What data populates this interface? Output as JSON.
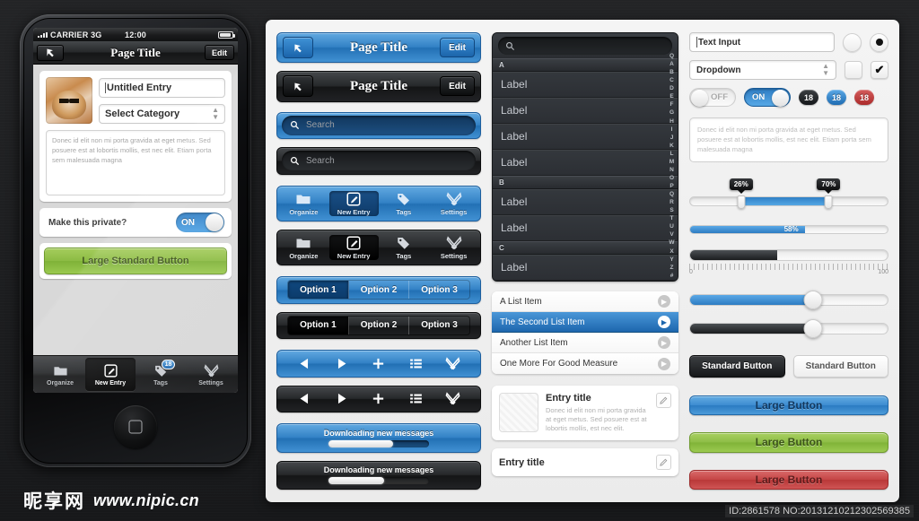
{
  "phone": {
    "status": {
      "carrier": "CARRIER 3G",
      "time": "12:00"
    },
    "nav": {
      "title": "Page Title",
      "edit": "Edit",
      "back_icon": "back-arrow-icon"
    },
    "form": {
      "title_value": "Untitled Entry",
      "category_value": "Select Category",
      "note_text": "Donec id elit non mi porta gravida at eget metus. Sed posuere est at lobortis mollis, est nec elit. Etiam porta sem malesuada magna",
      "private_label": "Make this private?",
      "toggle_state": "ON",
      "button_label": "Large Standard Button"
    },
    "tabs": [
      {
        "label": "Organize",
        "icon": "folder-icon",
        "active": false,
        "badge": ""
      },
      {
        "label": "New Entry",
        "icon": "compose-icon",
        "active": true,
        "badge": ""
      },
      {
        "label": "Tags",
        "icon": "tag-icon",
        "active": false,
        "badge": "18"
      },
      {
        "label": "Settings",
        "icon": "tools-icon",
        "active": false,
        "badge": ""
      }
    ]
  },
  "kit": {
    "navbars": [
      {
        "title": "Page Title",
        "edit": "Edit",
        "style": "blue"
      },
      {
        "title": "Page Title",
        "edit": "Edit",
        "style": "dark"
      }
    ],
    "searchbars": [
      {
        "placeholder": "Search",
        "style": "blue"
      },
      {
        "placeholder": "Search",
        "style": "dark"
      }
    ],
    "tabbars": [
      {
        "style": "blue",
        "items": [
          {
            "label": "Organize",
            "icon": "folder-icon",
            "active": false
          },
          {
            "label": "New Entry",
            "icon": "compose-icon",
            "active": true
          },
          {
            "label": "Tags",
            "icon": "tag-icon",
            "active": false
          },
          {
            "label": "Settings",
            "icon": "tools-icon",
            "active": false
          }
        ]
      },
      {
        "style": "dark",
        "items": [
          {
            "label": "Organize",
            "icon": "folder-icon",
            "active": false
          },
          {
            "label": "New Entry",
            "icon": "compose-icon",
            "active": true
          },
          {
            "label": "Tags",
            "icon": "tag-icon",
            "active": false
          },
          {
            "label": "Settings",
            "icon": "tools-icon",
            "active": false
          }
        ]
      }
    ],
    "segmented": [
      {
        "style": "blue",
        "options": [
          "Option 1",
          "Option 2",
          "Option 3"
        ],
        "selected": 0
      },
      {
        "style": "dark",
        "options": [
          "Option 1",
          "Option 2",
          "Option 3"
        ],
        "selected": 0
      }
    ],
    "toolbars": [
      {
        "style": "blue",
        "icons": [
          "prev-icon",
          "play-icon",
          "plus-icon",
          "list-icon",
          "tools-icon"
        ]
      },
      {
        "style": "dark",
        "icons": [
          "prev-icon",
          "play-icon",
          "plus-icon",
          "list-icon",
          "tools-icon"
        ]
      }
    ],
    "progress": [
      {
        "style": "blue",
        "label": "Downloading new messages",
        "percent": 64
      },
      {
        "style": "dark",
        "label": "Downloading new messages",
        "percent": 55
      }
    ]
  },
  "indexlist": {
    "search_icon": "search-icon",
    "sections": [
      {
        "header": "A",
        "items": [
          "Label",
          "Label",
          "Label",
          "Label"
        ]
      },
      {
        "header": "B",
        "items": [
          "Label",
          "Label"
        ]
      },
      {
        "header": "C",
        "items": [
          "Label"
        ]
      }
    ],
    "index": [
      "Q",
      "A",
      "B",
      "C",
      "D",
      "E",
      "F",
      "G",
      "H",
      "I",
      "J",
      "K",
      "L",
      "M",
      "N",
      "O",
      "P",
      "Q",
      "R",
      "S",
      "T",
      "U",
      "V",
      "W",
      "X",
      "Y",
      "Z",
      "#"
    ]
  },
  "whitelist": {
    "items": [
      {
        "label": "A List Item",
        "selected": false
      },
      {
        "label": "The Second List Item",
        "selected": true
      },
      {
        "label": "Another List Item",
        "selected": false
      },
      {
        "label": "One More For Good Measure",
        "selected": false
      }
    ]
  },
  "entrycards": [
    {
      "title": "Entry title",
      "desc": "Donec id elit non mi porta gravida at eget metus. Sed posuere est at lobortis mollis, est nec elit.",
      "edit_icon": "pencil-icon"
    },
    {
      "title": "Entry title",
      "desc": "",
      "edit_icon": "pencil-icon"
    }
  ],
  "controls": {
    "text_input_value": "Text Input",
    "dropdown_value": "Dropdown",
    "radio_off": "radio-unchecked-icon",
    "radio_on": "radio-checked-icon",
    "checkbox_off": "checkbox-unchecked-icon",
    "checkbox_on": "checkbox-checked-icon",
    "toggle_off_label": "OFF",
    "toggle_on_label": "ON",
    "badges": [
      {
        "value": "18",
        "color": "#2a2c2e"
      },
      {
        "value": "18",
        "color": "#2d7cc2"
      },
      {
        "value": "18",
        "color": "#c0392b"
      }
    ],
    "textarea_text": "Donec id elit non mi porta gravida at eget metus. Sed posuere est at lobortis mollis, est nec elit. Etiam porta sem malesuada magna",
    "range_slider": {
      "low_label": "26%",
      "low": 26,
      "high_label": "70%",
      "high": 70
    },
    "fill_slider": {
      "label": "58%",
      "percent": 58
    },
    "ruler_slider": {
      "percent": 44,
      "min_label": "0",
      "max_label": "100"
    },
    "knob_sliders": [
      {
        "percent": 62,
        "style": "blue"
      },
      {
        "percent": 62,
        "style": "dark"
      }
    ],
    "standard_buttons": [
      {
        "label": "Standard Button",
        "style": "dark"
      },
      {
        "label": "Standard Button",
        "style": "light"
      }
    ],
    "large_buttons": [
      {
        "label": "Large Button",
        "style": "blue"
      },
      {
        "label": "Large Button",
        "style": "green"
      },
      {
        "label": "Large Button",
        "style": "red"
      }
    ]
  },
  "watermark": {
    "cn": "昵享网",
    "url": "www.nipic.cn",
    "id": "ID:2861578 NO:20131210212302569385"
  }
}
